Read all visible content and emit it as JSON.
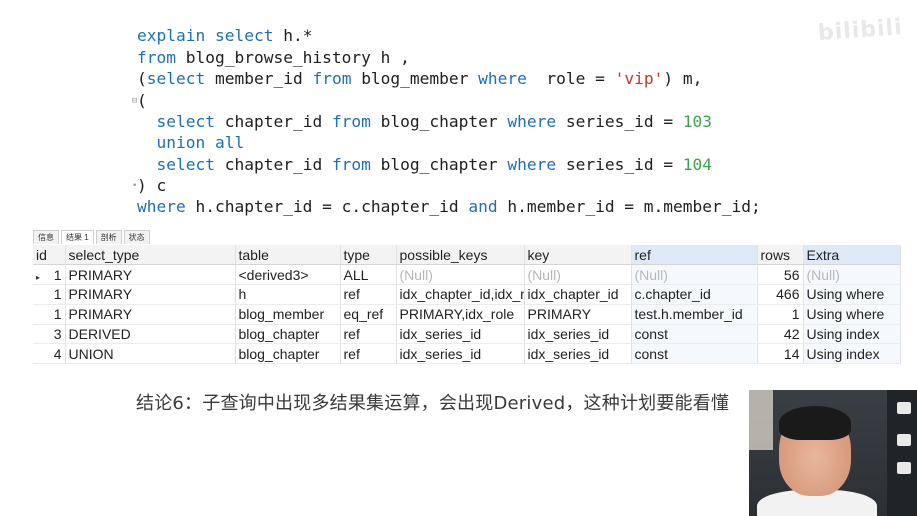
{
  "editor": {
    "lines": [
      {
        "marker": "",
        "parts": [
          {
            "t": "explain ",
            "c": "kw"
          },
          {
            "t": "select ",
            "c": "kw"
          },
          {
            "t": "h.*",
            "c": ""
          }
        ]
      },
      {
        "marker": "",
        "parts": [
          {
            "t": "from ",
            "c": "kw"
          },
          {
            "t": "blog_browse_history h ,",
            "c": ""
          }
        ]
      },
      {
        "marker": "",
        "parts": [
          {
            "t": "(",
            "c": ""
          },
          {
            "t": "select ",
            "c": "kw"
          },
          {
            "t": "member_id ",
            "c": ""
          },
          {
            "t": "from ",
            "c": "kw"
          },
          {
            "t": "blog_member ",
            "c": ""
          },
          {
            "t": "where ",
            "c": "kw"
          },
          {
            "t": " role = ",
            "c": ""
          },
          {
            "t": "'vip'",
            "c": "str"
          },
          {
            "t": ") m,",
            "c": ""
          }
        ]
      },
      {
        "marker": "⊟",
        "parts": [
          {
            "t": "(",
            "c": ""
          }
        ]
      },
      {
        "marker": "",
        "parts": [
          {
            "t": "  ",
            "c": ""
          },
          {
            "t": "select ",
            "c": "kw"
          },
          {
            "t": "chapter_id ",
            "c": ""
          },
          {
            "t": "from ",
            "c": "kw"
          },
          {
            "t": "blog_chapter ",
            "c": ""
          },
          {
            "t": "where ",
            "c": "kw"
          },
          {
            "t": "series_id = ",
            "c": ""
          },
          {
            "t": "103",
            "c": "num"
          }
        ]
      },
      {
        "marker": "",
        "parts": [
          {
            "t": "  ",
            "c": ""
          },
          {
            "t": "union all",
            "c": "kw"
          }
        ]
      },
      {
        "marker": "",
        "parts": [
          {
            "t": "  ",
            "c": ""
          },
          {
            "t": "select ",
            "c": "kw"
          },
          {
            "t": "chapter_id ",
            "c": ""
          },
          {
            "t": "from ",
            "c": "kw"
          },
          {
            "t": "blog_chapter ",
            "c": ""
          },
          {
            "t": "where ",
            "c": "kw"
          },
          {
            "t": "series_id = ",
            "c": ""
          },
          {
            "t": "104",
            "c": "num"
          }
        ]
      },
      {
        "marker": "•",
        "parts": [
          {
            "t": ") c",
            "c": ""
          }
        ]
      },
      {
        "marker": "",
        "parts": [
          {
            "t": "where ",
            "c": "kw"
          },
          {
            "t": "h.chapter_id = c.chapter_id ",
            "c": ""
          },
          {
            "t": "and ",
            "c": "kw"
          },
          {
            "t": "h.member_id = m.member_id;",
            "c": ""
          }
        ]
      }
    ]
  },
  "logo": {
    "text": "bilibili"
  },
  "tabs": [
    "信息",
    "结果 1",
    "剖析",
    "状态"
  ],
  "grid": {
    "columns": [
      "id",
      "select_type",
      "table",
      "type",
      "possible_keys",
      "key",
      "ref",
      "rows",
      "Extra"
    ],
    "rows": [
      [
        "1",
        "PRIMARY",
        "<derived3>",
        "ALL",
        "(Null)",
        "(Null)",
        "(Null)",
        "56",
        "(Null)"
      ],
      [
        "1",
        "PRIMARY",
        "h",
        "ref",
        "idx_chapter_id,idx_m",
        "idx_chapter_id",
        "c.chapter_id",
        "466",
        "Using where"
      ],
      [
        "1",
        "PRIMARY",
        "blog_member",
        "eq_ref",
        "PRIMARY,idx_role",
        "PRIMARY",
        "test.h.member_id",
        "1",
        "Using where"
      ],
      [
        "3",
        "DERIVED",
        "blog_chapter",
        "ref",
        "idx_series_id",
        "idx_series_id",
        "const",
        "42",
        "Using index"
      ],
      [
        "4",
        "UNION",
        "blog_chapter",
        "ref",
        "idx_series_id",
        "idx_series_id",
        "const",
        "14",
        "Using index"
      ]
    ],
    "row_marker": "▸"
  },
  "caption": "结论6：子查询中出现多结果集运算，会出现Derived，这种计划要能看懂",
  "colors": {
    "keyword": "#1f6fb5",
    "number": "#3aa64a",
    "string": "#c0392b",
    "null": "#b8b8b8"
  }
}
